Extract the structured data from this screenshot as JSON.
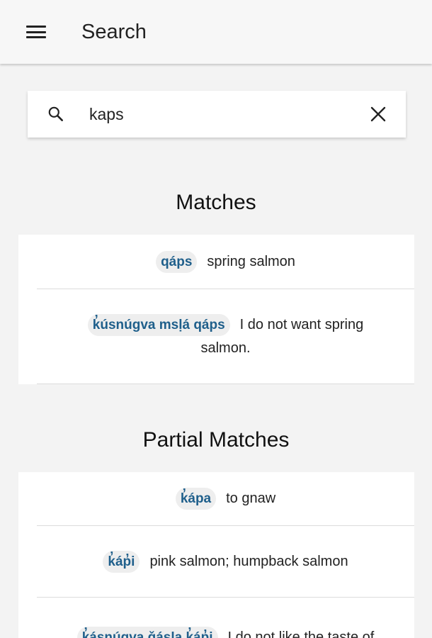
{
  "appbar": {
    "title": "Search",
    "menu_icon": "hamburger-menu-icon"
  },
  "search": {
    "value": "kaps",
    "search_icon": "magnifier-icon",
    "clear_icon": "close-icon"
  },
  "matches": {
    "heading": "Matches",
    "items": [
      {
        "term": "qáps",
        "gloss": "spring salmon"
      },
      {
        "term": "k̓úsnúgva msḷá qáps",
        "gloss": "I do not want spring salmon."
      }
    ]
  },
  "partial_matches": {
    "heading": "Partial Matches",
    "items": [
      {
        "term": "k̓ápa",
        "gloss": "to gnaw"
      },
      {
        "term": "k̓áp̓i",
        "gloss": "pink salmon; humpback salmon"
      },
      {
        "term": "k̓ásnúgva ǧásla k̓áp̓i",
        "gloss": "I do not like the taste of"
      }
    ]
  },
  "colors": {
    "term_text": "#1f5f8b",
    "term_bg": "#eeeeee",
    "page_bg": "#f3f3f3",
    "card_bg": "#ffffff"
  }
}
